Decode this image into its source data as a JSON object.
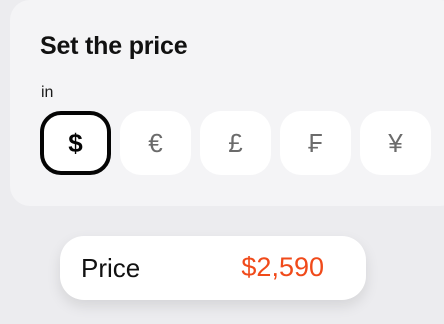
{
  "title": "Set the price",
  "subtitle": "in",
  "currencies": [
    {
      "symbol": "$",
      "selected": true
    },
    {
      "symbol": "€",
      "selected": false
    },
    {
      "symbol": "£",
      "selected": false
    },
    {
      "symbol": "₣",
      "selected": false
    },
    {
      "symbol": "¥",
      "selected": false
    }
  ],
  "price": {
    "label": "Price",
    "value": "$2,590"
  },
  "colors": {
    "background": "#ececef",
    "panel": "#f4f4f6",
    "price_accent": "#f04a1a",
    "selected_border": "#050505"
  }
}
